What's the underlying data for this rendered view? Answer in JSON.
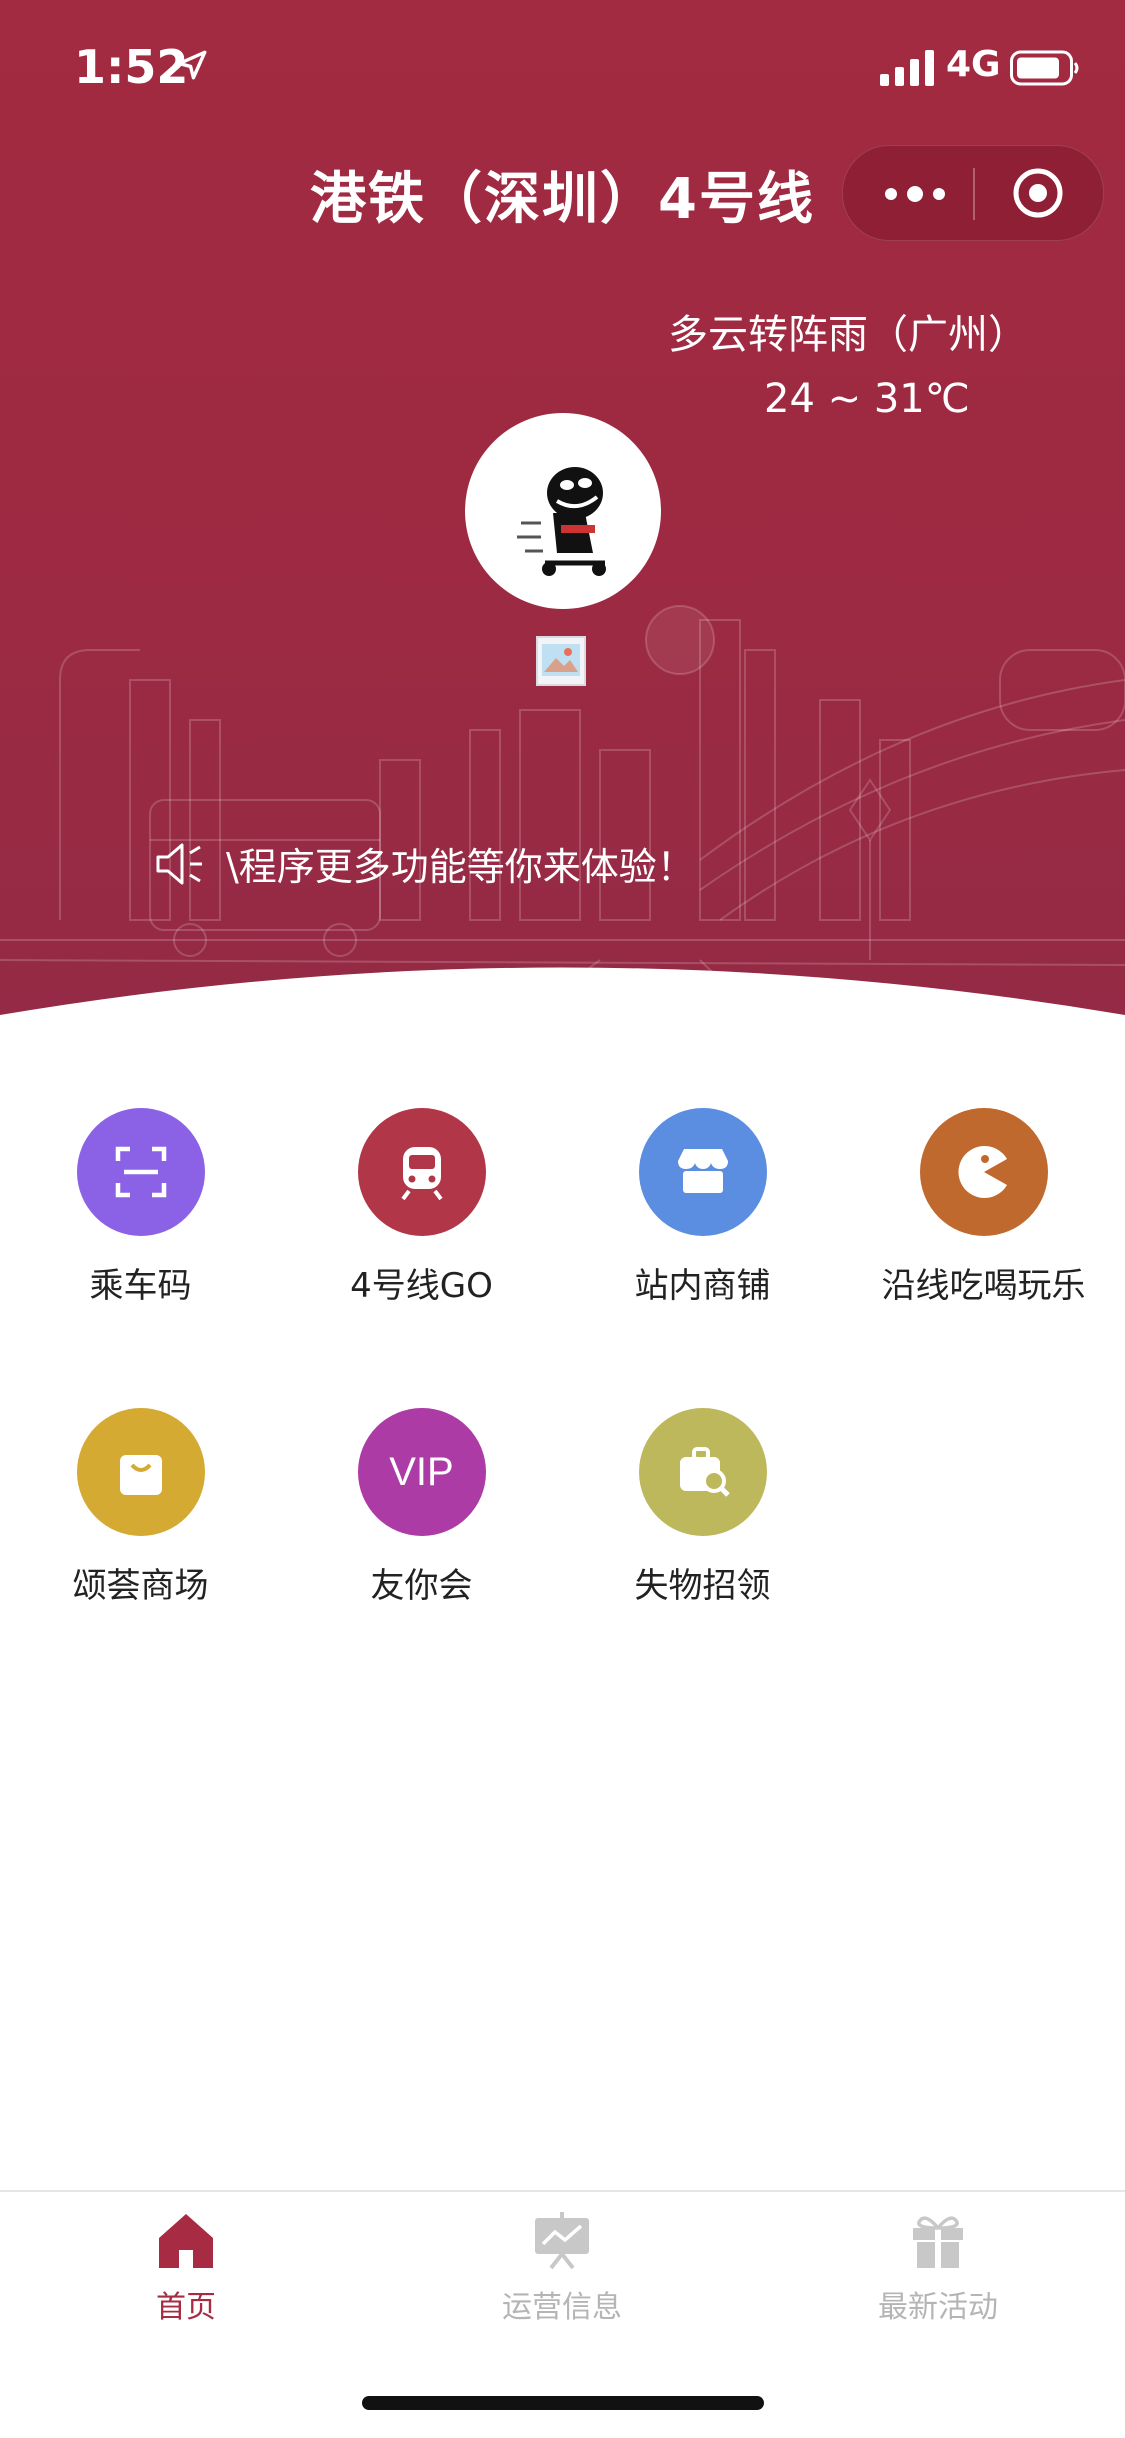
{
  "status_bar": {
    "time": "1:52",
    "network": "4G"
  },
  "header": {
    "title": "港铁（深圳）4号线"
  },
  "weather": {
    "condition": "多云转阵雨（广州）",
    "temperature": "24 ~ 31℃"
  },
  "notice": {
    "text": "\\程序更多功能等你来体验！"
  },
  "menu": [
    {
      "label": "乘车码",
      "icon": "scan-code-icon",
      "color": "#8b62e6"
    },
    {
      "label": "4号线GO",
      "icon": "train-icon",
      "color": "#b03648"
    },
    {
      "label": "站内商铺",
      "icon": "shop-icon",
      "color": "#5b8ee0"
    },
    {
      "label": "沿线吃喝玩乐",
      "icon": "pacman-icon",
      "color": "#c0692f"
    },
    {
      "label": "颂荟商场",
      "icon": "shopping-bag-icon",
      "color": "#d4aa33"
    },
    {
      "label": "友你会",
      "icon": "vip-icon",
      "icon_text": "VIP",
      "color": "#ad3ba6"
    },
    {
      "label": "失物招领",
      "icon": "lost-found-icon",
      "color": "#bdb85b"
    }
  ],
  "tabbar": {
    "items": [
      {
        "label": "首页",
        "icon": "home-icon",
        "active": true
      },
      {
        "label": "运营信息",
        "icon": "presentation-icon",
        "active": false
      },
      {
        "label": "最新活动",
        "icon": "gift-icon",
        "active": false
      }
    ],
    "active_color": "#a72b43",
    "inactive_color": "#b5b5b5"
  }
}
